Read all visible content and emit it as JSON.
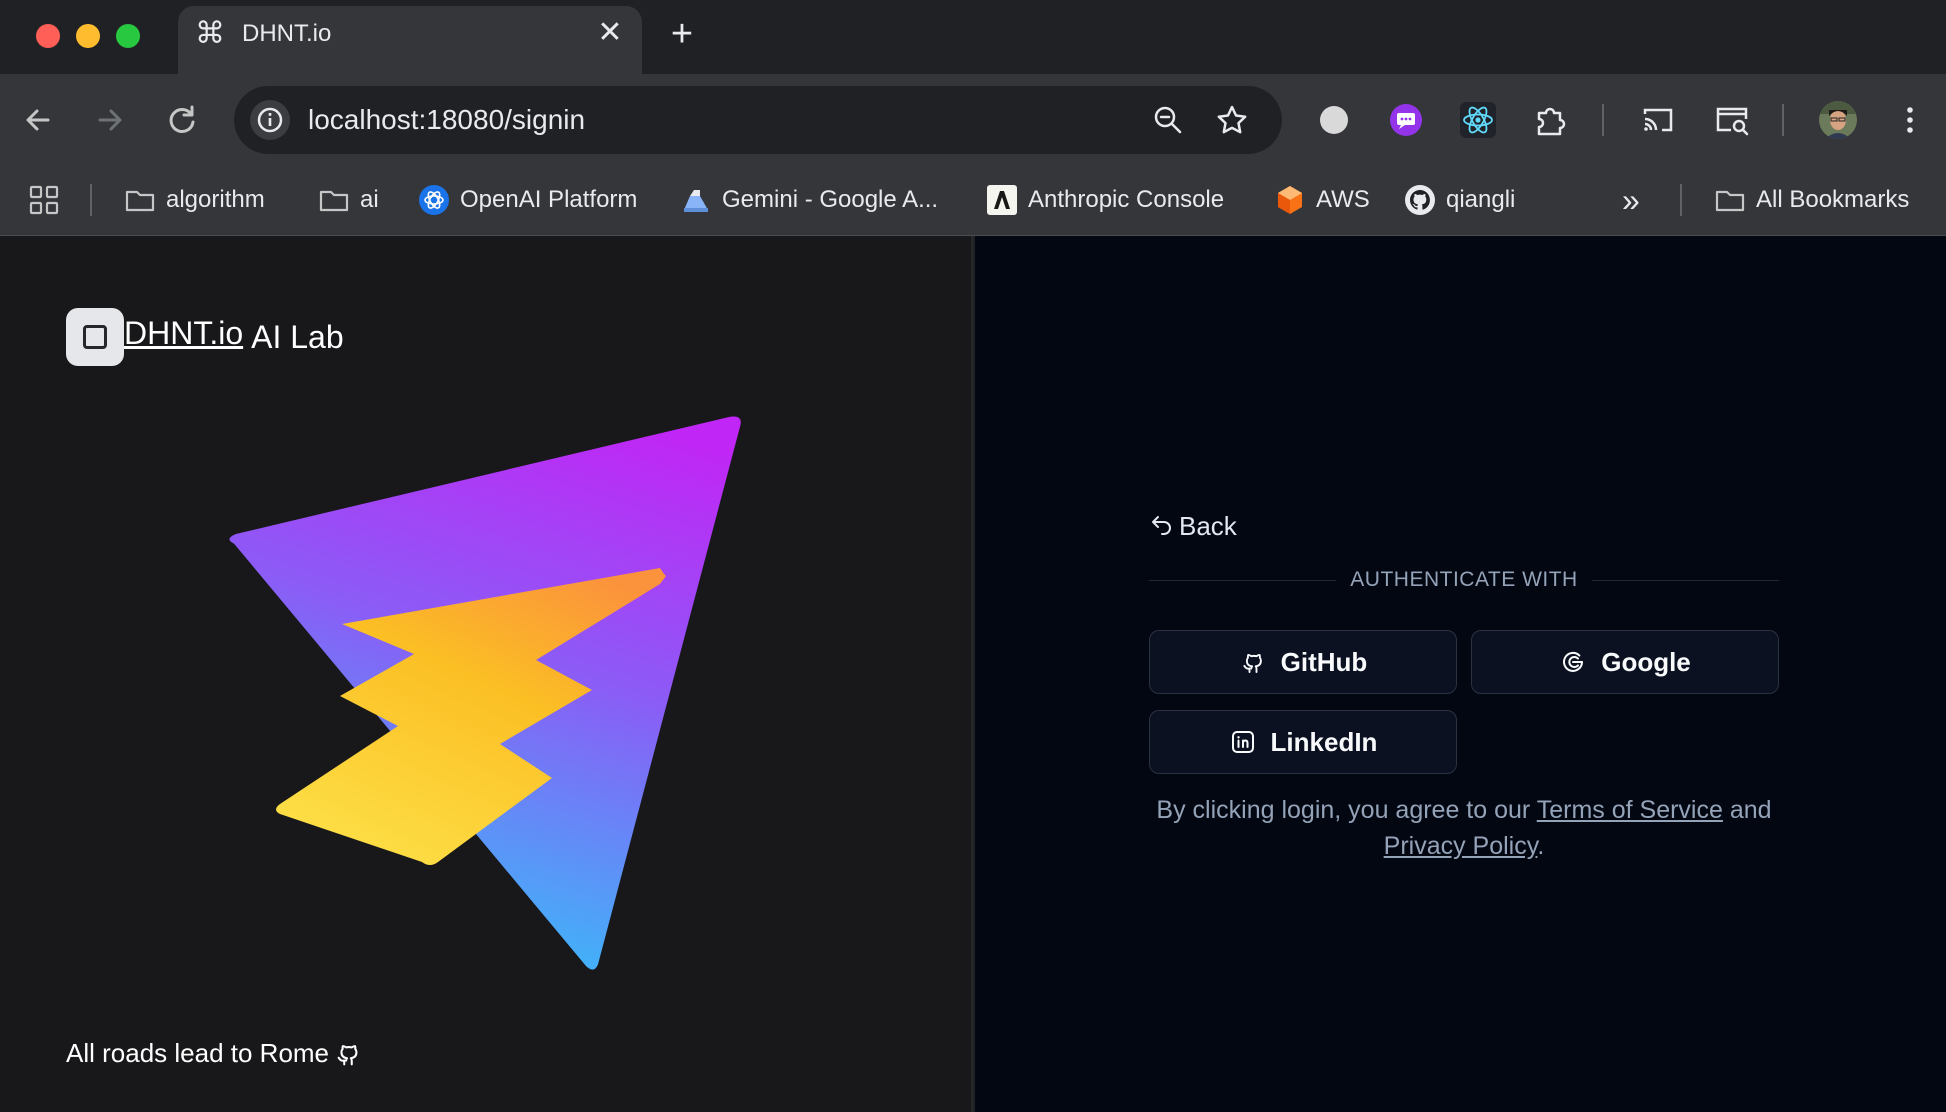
{
  "browser": {
    "tab_title": "DHNT.io",
    "tab_close": "✕",
    "new_tab": "+",
    "url": "localhost:18080/signin",
    "bookmarks": [
      {
        "label": "algorithm",
        "icon": "folder-icon"
      },
      {
        "label": "ai",
        "icon": "folder-icon"
      },
      {
        "label": "OpenAI Platform",
        "icon": "openai-icon"
      },
      {
        "label": "Gemini - Google A...",
        "icon": "gemini-icon"
      },
      {
        "label": "Anthropic Console",
        "icon": "anthropic-icon"
      },
      {
        "label": "AWS",
        "icon": "aws-icon"
      },
      {
        "label": "qiangli",
        "icon": "github-icon"
      }
    ],
    "all_bookmarks": "All Bookmarks",
    "overflow": "»"
  },
  "brand": {
    "name": "DHNT.io",
    "subtitle": "AI Lab"
  },
  "footer": {
    "tagline": "All roads lead to Rome"
  },
  "auth": {
    "back_label": "Back",
    "divider_label": "AUTHENTICATE WITH",
    "providers": [
      {
        "label": "GitHub",
        "icon": "github-icon"
      },
      {
        "label": "Google",
        "icon": "google-icon"
      },
      {
        "label": "LinkedIn",
        "icon": "linkedin-icon"
      }
    ],
    "legal": {
      "prefix": "By clicking login, you agree to our ",
      "terms": "Terms of Service",
      "middle": " and ",
      "privacy": "Privacy Policy",
      "suffix": "."
    }
  },
  "colors": {
    "left_panel": "#18181b",
    "right_panel": "#030712",
    "logo_purple": "#c026f5",
    "logo_blue": "#38bdf8",
    "logo_yellow": "#fde047",
    "logo_orange": "#fbbf24"
  }
}
